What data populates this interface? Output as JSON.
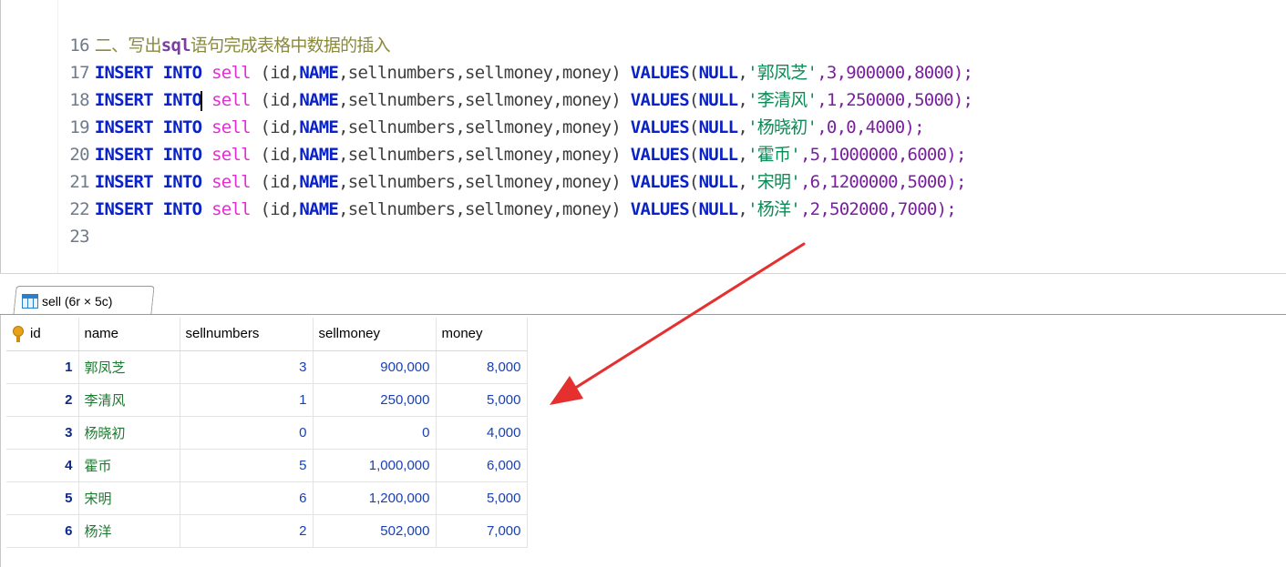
{
  "editor": {
    "lines": [
      {
        "num": "16",
        "comment_a": "二、写出",
        "comment_kw": "sql",
        "comment_b": "语句完成表格中数据的插入"
      },
      {
        "num": "17",
        "kw1": "INSERT",
        "kw2": "INTO",
        "table": "sell",
        "cols_open": "(id,",
        "col_name": "NAME",
        "cols_rest": ",sellnumbers,sellmoney,money)",
        "values_kw": "VALUES",
        "null_kw": "NULL",
        "name": "'郭凤芝'",
        "nums": ",3,900000,8000);"
      },
      {
        "num": "18",
        "kw1": "INSERT",
        "kw2": "INTO",
        "table": "sell",
        "cols_open": "(id,",
        "col_name": "NAME",
        "cols_rest": ",sellnumbers,sellmoney,money)",
        "values_kw": "VALUES",
        "null_kw": "NULL",
        "name": "'李清风'",
        "nums": ",1,250000,5000);"
      },
      {
        "num": "19",
        "kw1": "INSERT",
        "kw2": "INTO",
        "table": "sell",
        "cols_open": "(id,",
        "col_name": "NAME",
        "cols_rest": ",sellnumbers,sellmoney,money)",
        "values_kw": "VALUES",
        "null_kw": "NULL",
        "name": "'杨晓初'",
        "nums": ",0,0,4000);"
      },
      {
        "num": "20",
        "kw1": "INSERT",
        "kw2": "INTO",
        "table": "sell",
        "cols_open": "(id,",
        "col_name": "NAME",
        "cols_rest": ",sellnumbers,sellmoney,money)",
        "values_kw": "VALUES",
        "null_kw": "NULL",
        "name": "'霍币'",
        "nums": ",5,1000000,6000);"
      },
      {
        "num": "21",
        "kw1": "INSERT",
        "kw2": "INTO",
        "table": "sell",
        "cols_open": "(id,",
        "col_name": "NAME",
        "cols_rest": ",sellnumbers,sellmoney,money)",
        "values_kw": "VALUES",
        "null_kw": "NULL",
        "name": "'宋明'",
        "nums": ",6,1200000,5000);"
      },
      {
        "num": "22",
        "kw1": "INSERT",
        "kw2": "INTO",
        "table": "sell",
        "cols_open": "(id,",
        "col_name": "NAME",
        "cols_rest": ",sellnumbers,sellmoney,money)",
        "values_kw": "VALUES",
        "null_kw": "NULL",
        "name": "'杨洋'",
        "nums": ",2,502000,7000);"
      },
      {
        "num": "23"
      }
    ]
  },
  "result_tab": {
    "label": "sell (6r × 5c)",
    "icon": "table-grid-icon"
  },
  "result": {
    "key_icon": "primary-key-icon",
    "headers": [
      "id",
      "name",
      "sellnumbers",
      "sellmoney",
      "money"
    ],
    "rows": [
      [
        "1",
        "郭凤芝",
        "3",
        "900,000",
        "8,000"
      ],
      [
        "2",
        "李清风",
        "1",
        "250,000",
        "5,000"
      ],
      [
        "3",
        "杨晓初",
        "0",
        "0",
        "4,000"
      ],
      [
        "4",
        "霍币",
        "5",
        "1,000,000",
        "6,000"
      ],
      [
        "5",
        "宋明",
        "6",
        "1,200,000",
        "5,000"
      ],
      [
        "6",
        "杨洋",
        "2",
        "502,000",
        "7,000"
      ]
    ]
  },
  "colors": {
    "keyword": "#0a22c9",
    "table_name": "#e02fd0",
    "string": "#0d8a55",
    "number": "#7a1fa0",
    "comment": "#8a8a3e",
    "annotation_arrow": "#e53030"
  }
}
